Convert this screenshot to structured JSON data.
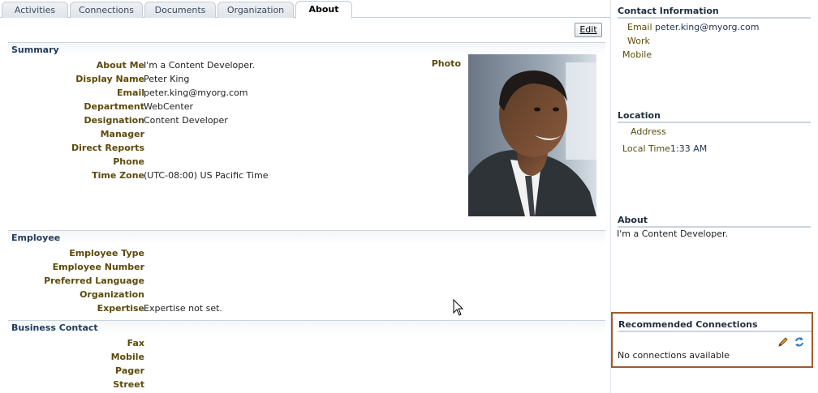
{
  "tabs": [
    {
      "label": "Activities",
      "active": false
    },
    {
      "label": "Connections",
      "active": false
    },
    {
      "label": "Documents",
      "active": false
    },
    {
      "label": "Organization",
      "active": false
    },
    {
      "label": "About",
      "active": true
    }
  ],
  "toolbar": {
    "edit_label": "Edit"
  },
  "summary": {
    "title": "Summary",
    "photo_label": "Photo",
    "rows": [
      {
        "label": "About Me",
        "value": "I'm a Content Developer."
      },
      {
        "label": "Display Name",
        "value": "Peter King"
      },
      {
        "label": "Email",
        "value": "peter.king@myorg.com"
      },
      {
        "label": "Department",
        "value": "WebCenter"
      },
      {
        "label": "Designation",
        "value": "Content Developer"
      },
      {
        "label": "Manager",
        "value": ""
      },
      {
        "label": "Direct Reports",
        "value": ""
      },
      {
        "label": "Phone",
        "value": ""
      },
      {
        "label": "Time Zone",
        "value": "(UTC-08:00) US Pacific Time"
      }
    ]
  },
  "employee": {
    "title": "Employee",
    "rows": [
      {
        "label": "Employee Type",
        "value": ""
      },
      {
        "label": "Employee Number",
        "value": ""
      },
      {
        "label": "Preferred Language",
        "value": ""
      },
      {
        "label": "Organization",
        "value": ""
      },
      {
        "label": "Expertise",
        "value": "Expertise not set."
      }
    ]
  },
  "business_contact": {
    "title": "Business Contact",
    "rows": [
      {
        "label": "Fax",
        "value": ""
      },
      {
        "label": "Mobile",
        "value": ""
      },
      {
        "label": "Pager",
        "value": ""
      },
      {
        "label": "Street",
        "value": ""
      }
    ]
  },
  "sidebar": {
    "contact": {
      "title": "Contact Information",
      "email_label": "Email",
      "email_value": "peter.king@myorg.com",
      "work_label": "Work",
      "mobile_label": "Mobile"
    },
    "location": {
      "title": "Location",
      "address_label": "Address",
      "local_time_label": "Local Time",
      "local_time_value": "1:33 AM"
    },
    "about": {
      "title": "About",
      "text": "I'm a Content Developer."
    },
    "recommended": {
      "title": "Recommended Connections",
      "empty_text": "No connections available",
      "border_color": "#a35a2a"
    }
  },
  "icons": [
    "pencil-icon",
    "refresh-icon",
    "mouse-cursor-icon"
  ]
}
